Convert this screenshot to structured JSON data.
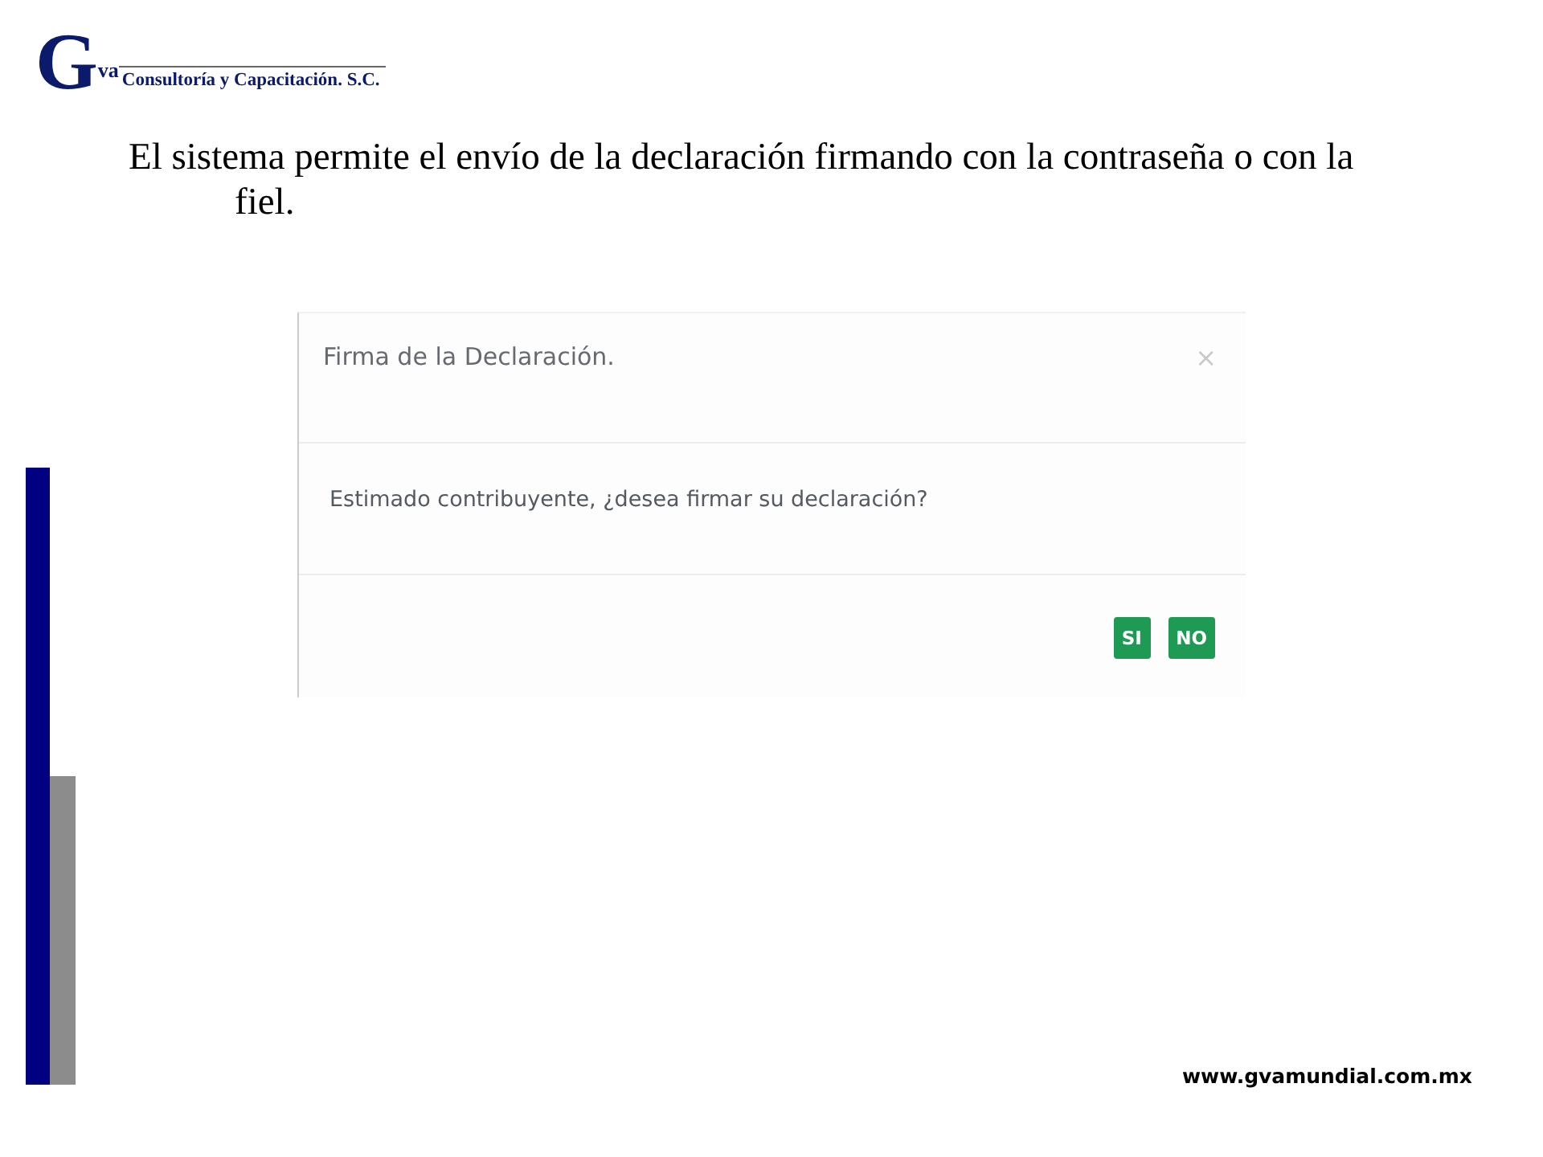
{
  "logo": {
    "initial": "G",
    "letters": "va",
    "company": "Consultoría y Capacitación. S.C."
  },
  "statement": "El sistema permite el envío de la declaración firmando con la contraseña o con la fiel.",
  "dialog": {
    "title": "Firma de la Declaración.",
    "close": "×",
    "message": "Estimado contribuyente, ¿desea firmar su declaración?",
    "buttons": [
      {
        "label": "SI"
      },
      {
        "label": "NO"
      }
    ]
  },
  "footer_url": "www.gvamundial.com.mx"
}
